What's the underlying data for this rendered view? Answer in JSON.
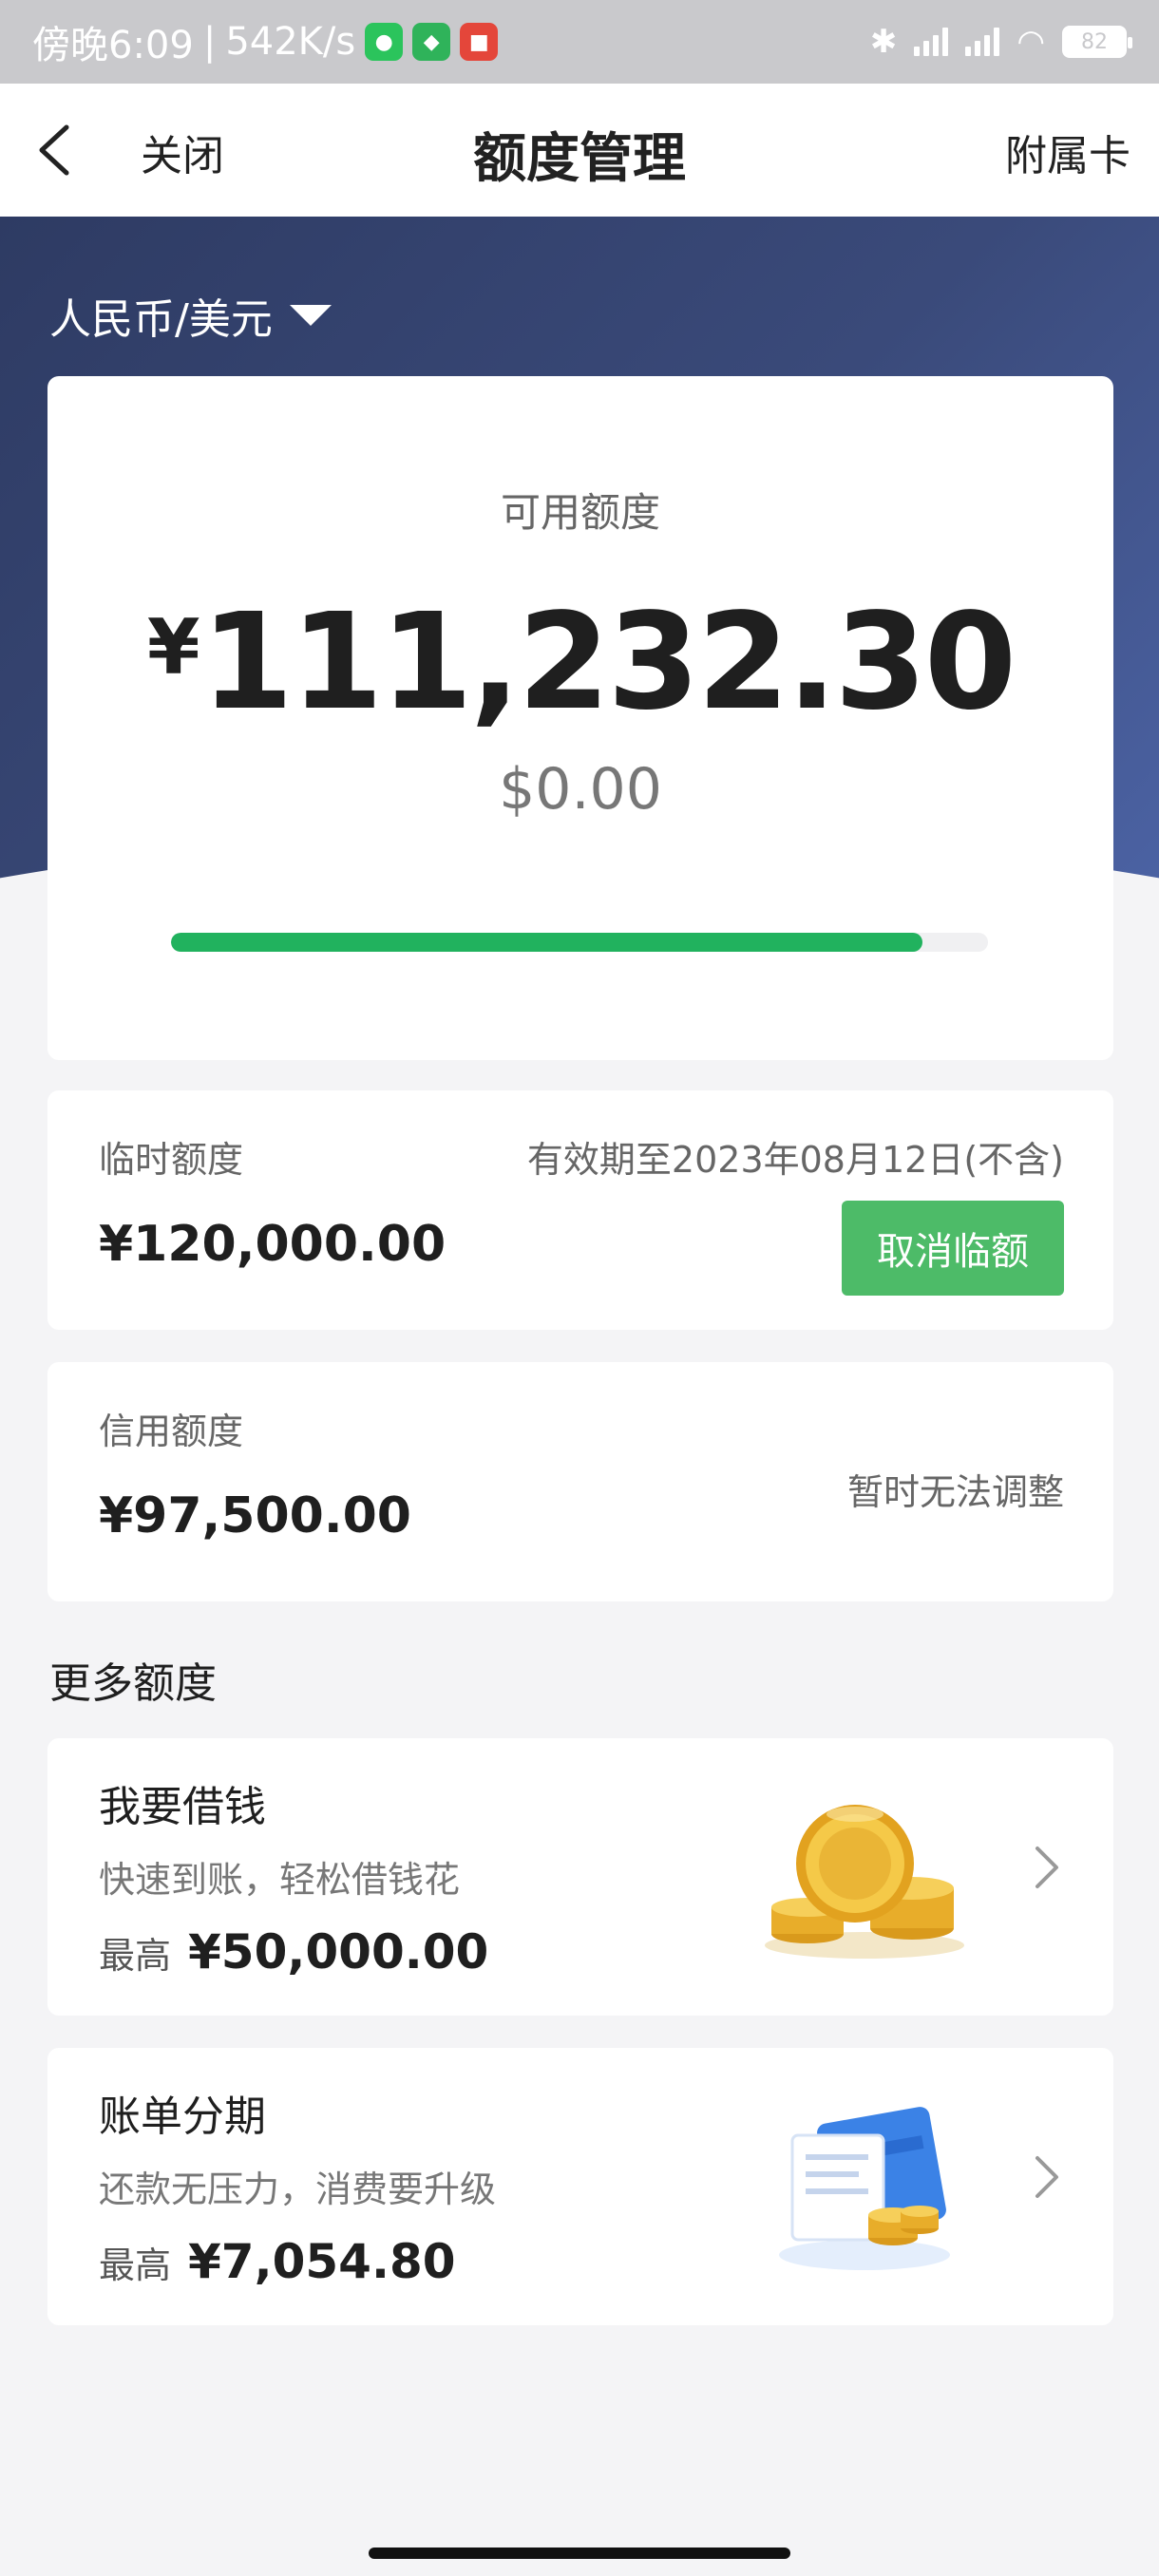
{
  "status_bar": {
    "time": "傍晚6:09",
    "separator": "|",
    "network_speed": "542K/s",
    "battery": "82",
    "colors": {
      "wechat": "#2bc45c",
      "shield": "#2fb35a",
      "app": "#e4463a"
    }
  },
  "nav": {
    "back_icon": "chevron-left-icon",
    "close_label": "关闭",
    "title": "额度管理",
    "supplementary_label": "附属卡"
  },
  "currency": {
    "selected": "人民币/美元",
    "icon": "caret-down-icon"
  },
  "available": {
    "label": "可用额度",
    "currency_symbol": "¥",
    "amount": "111,232.30",
    "usd_amount": "$0.00",
    "usage_fraction": 0.92,
    "bar_color": "#21b25e"
  },
  "temporary": {
    "label": "临时额度",
    "validity": "有效期至2023年08月12日(不含)",
    "amount": "¥120,000.00",
    "cancel_label": "取消临额",
    "button_color": "#4dbb68"
  },
  "credit": {
    "label": "信用额度",
    "amount": "¥97,500.00",
    "note": "暂时无法调整"
  },
  "more": {
    "title": "更多额度",
    "items": [
      {
        "title": "我要借钱",
        "subtitle": "快速到账，轻松借钱花",
        "max_label": "最高",
        "max_value": "¥50,000.00",
        "icon": "gold-coins-icon"
      },
      {
        "title": "账单分期",
        "subtitle": "还款无压力，消费要升级",
        "max_label": "最高",
        "max_value": "¥7,054.80",
        "icon": "bill-card-coins-icon"
      }
    ]
  }
}
